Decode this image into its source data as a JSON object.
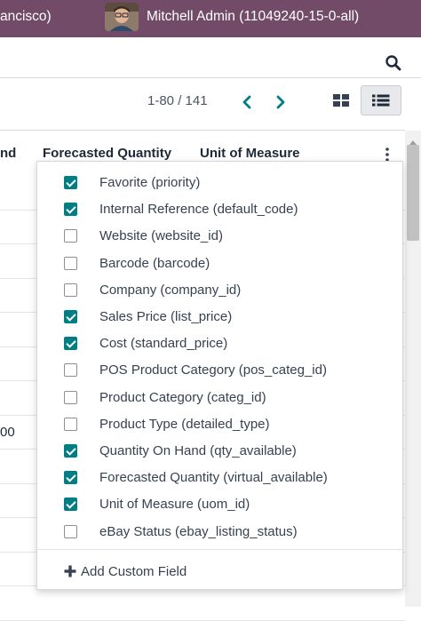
{
  "topbar": {
    "company": "ancisco)",
    "user_name": "Mitchell Admin (11049240-15-0-all)",
    "avatar_icon": "user-avatar"
  },
  "search": {
    "icon": "search-icon"
  },
  "pager": {
    "value": "1-80 / 141"
  },
  "views": {
    "active": "list"
  },
  "list": {
    "columns": [
      "nd",
      "Forecasted Quantity",
      "Unit of Measure"
    ],
    "row_cells": [
      "",
      "",
      "",
      "",
      "",
      "",
      "",
      "00",
      "",
      "",
      "",
      "",
      ""
    ]
  },
  "optional_columns": {
    "items": [
      {
        "label": "Favorite (priority)",
        "checked": true
      },
      {
        "label": "Internal Reference (default_code)",
        "checked": true
      },
      {
        "label": "Website (website_id)",
        "checked": false
      },
      {
        "label": "Barcode (barcode)",
        "checked": false
      },
      {
        "label": "Company (company_id)",
        "checked": false
      },
      {
        "label": "Sales Price (list_price)",
        "checked": true
      },
      {
        "label": "Cost (standard_price)",
        "checked": true
      },
      {
        "label": "POS Product Category (pos_categ_id)",
        "checked": false
      },
      {
        "label": "Product Category (categ_id)",
        "checked": false
      },
      {
        "label": "Product Type (detailed_type)",
        "checked": false
      },
      {
        "label": "Quantity On Hand (qty_available)",
        "checked": true
      },
      {
        "label": "Forecasted Quantity (virtual_available)",
        "checked": true
      },
      {
        "label": "Unit of Measure (uom_id)",
        "checked": true
      },
      {
        "label": "eBay Status (ebay_listing_status)",
        "checked": false
      }
    ],
    "add_custom_field": "Add Custom Field"
  },
  "colors": {
    "brand": "#714b67",
    "accent": "#017e84"
  }
}
